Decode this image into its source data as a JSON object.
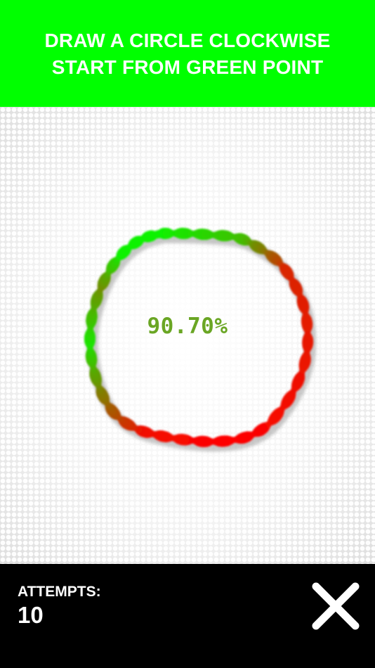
{
  "header": {
    "instruction_line1": "DRAW A CIRCLE CLOCKWISE",
    "instruction_line2": "START FROM GREEN POINT",
    "background_color": "#00ff00",
    "text_color": "#ffffff"
  },
  "board": {
    "score_text": "90.70%",
    "score_color": "#6aa624",
    "stroke_start_color": "#00ff00",
    "stroke_end_color": "#ff0000"
  },
  "footer": {
    "attempts_label": "ATTEMPTS:",
    "attempts_value": "10",
    "close_icon": "close-x-icon",
    "background_color": "#000000"
  }
}
